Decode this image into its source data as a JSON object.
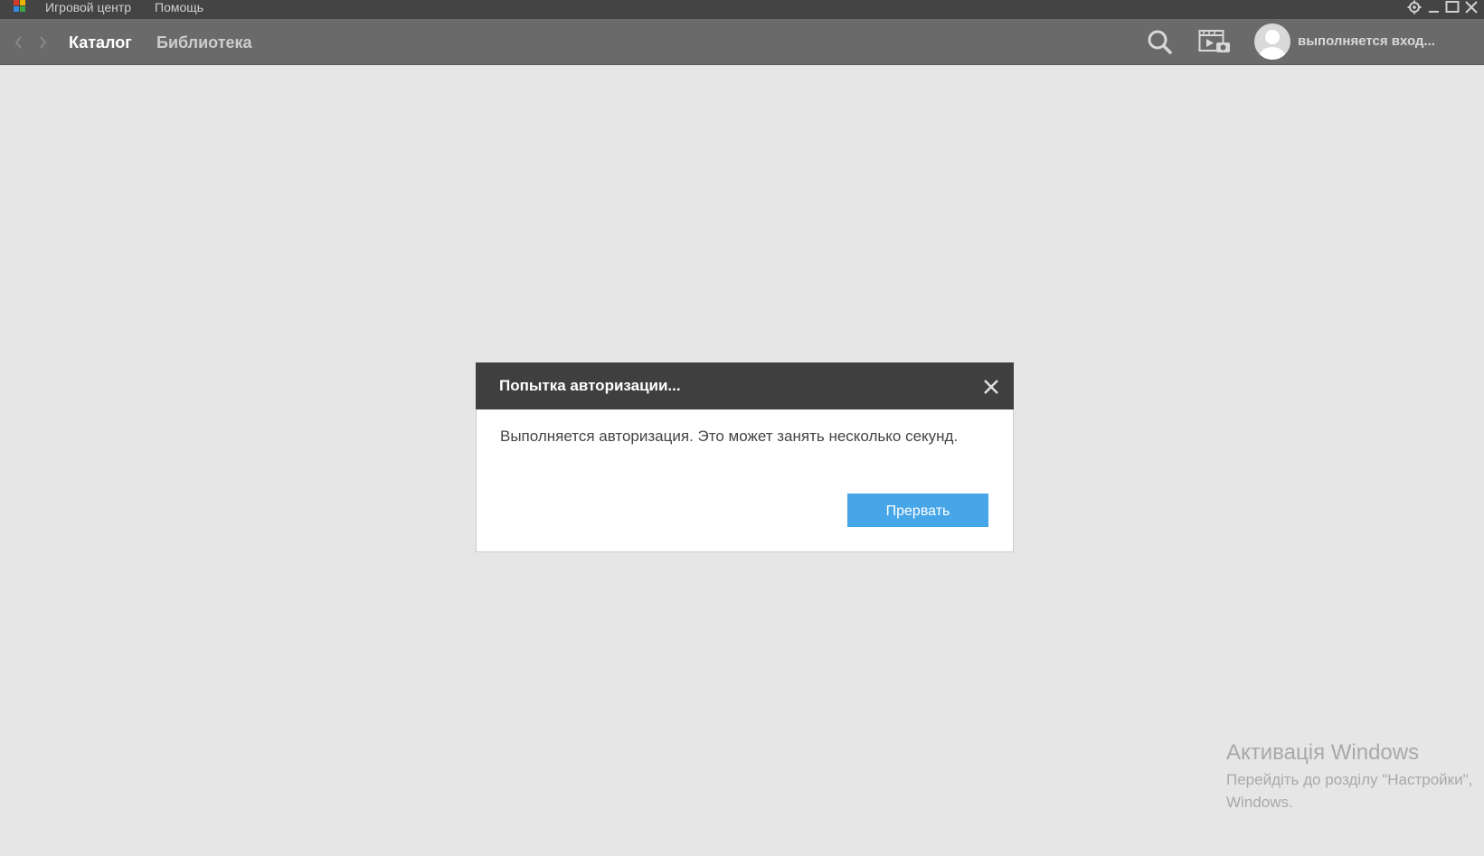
{
  "menubar": {
    "logo_icon": "app-logo-icon",
    "items": [
      "Игровой центр",
      "Помощь"
    ],
    "window_controls": [
      "gear-icon",
      "minimize-icon",
      "maximize-icon",
      "close-icon"
    ]
  },
  "navbar": {
    "back_icon": "chevron-left-icon",
    "forward_icon": "chevron-right-icon",
    "tabs": [
      {
        "label": "Каталог",
        "active": true
      },
      {
        "label": "Библиотека",
        "active": false
      }
    ],
    "search_icon": "search-icon",
    "media_icon": "video-camera-icon",
    "avatar_icon": "user-avatar-icon",
    "user_status": "выполняется вход..."
  },
  "dialog": {
    "title": "Попытка авторизации...",
    "message": "Выполняется авторизация. Это может занять несколько секунд.",
    "button_label": "Прервать",
    "close_icon": "close-icon"
  },
  "watermark": {
    "title": "Активація Windows",
    "line1": "Перейдіть до розділу \"Настройки\",",
    "line2": "Windows."
  },
  "colors": {
    "menubar_bg": "#444444",
    "navbar_bg": "#6a6a6a",
    "page_bg": "#e6e6e6",
    "dialog_header_bg": "#3f3f3f",
    "button_bg": "#47a6e8"
  }
}
